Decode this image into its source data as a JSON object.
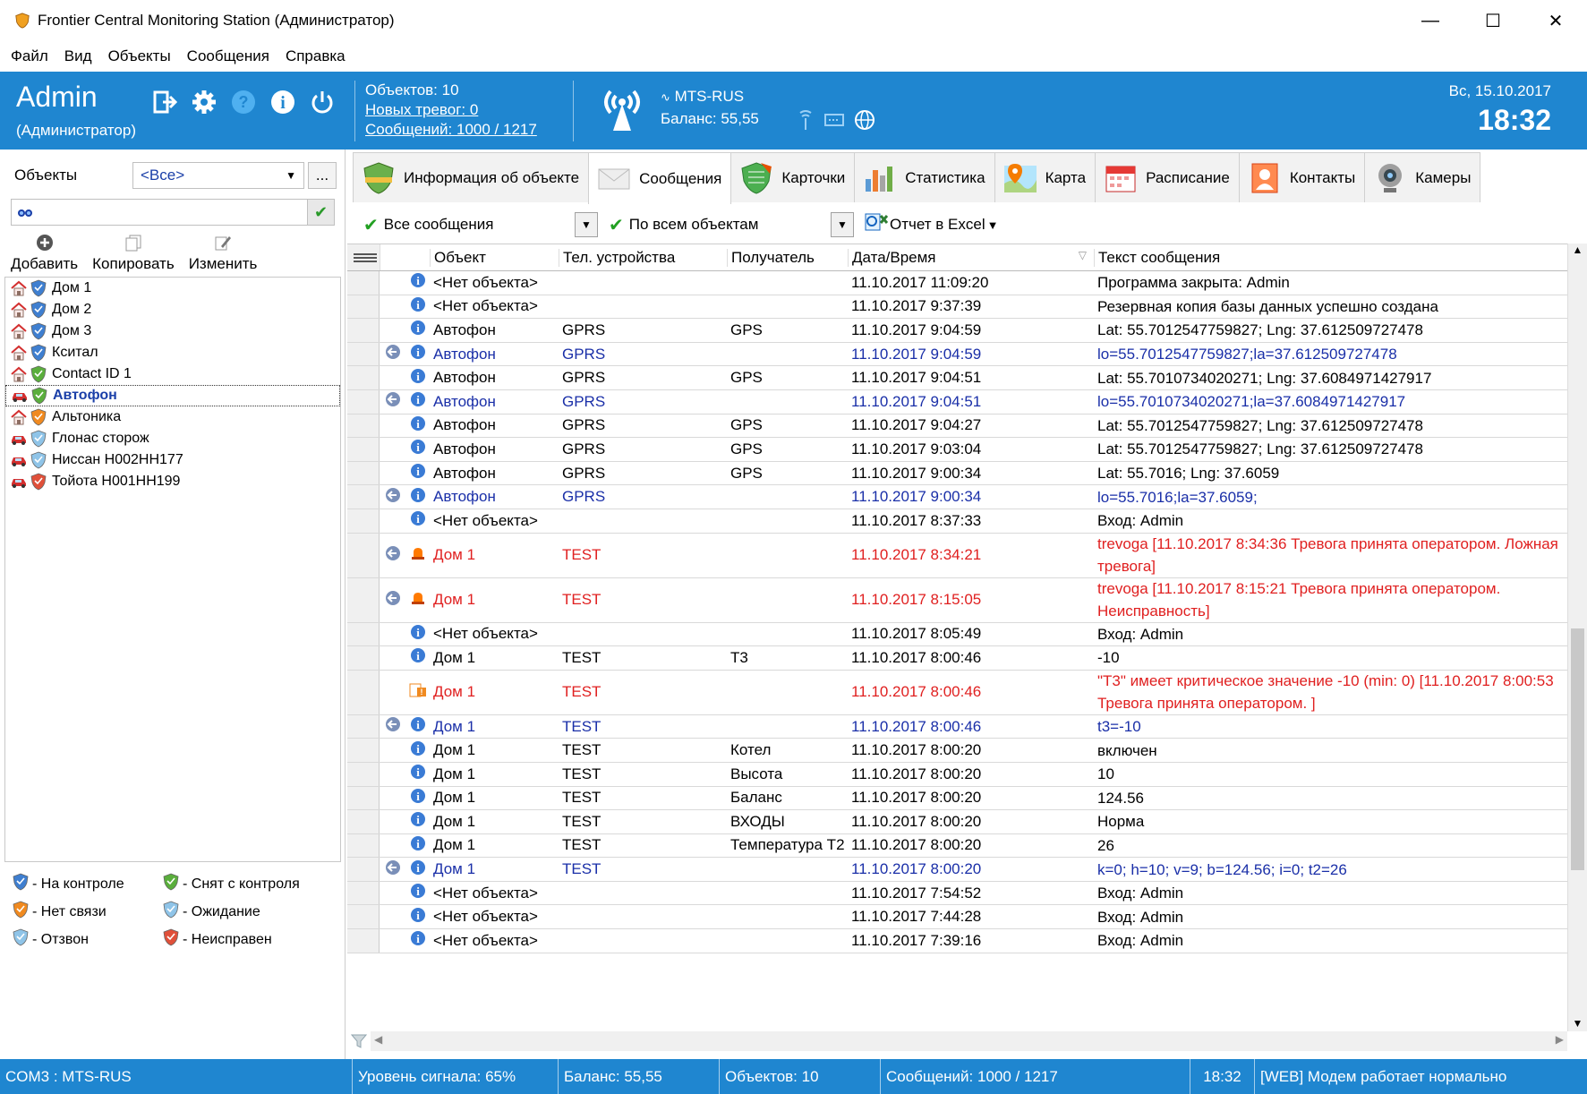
{
  "window": {
    "title": "Frontier Central Monitoring Station (Администратор)"
  },
  "menu": [
    "Файл",
    "Вид",
    "Объекты",
    "Сообщения",
    "Справка"
  ],
  "header": {
    "user": "Admin",
    "role": "(Администратор)",
    "objects": "Объектов:  10",
    "new_alarms": "Новых тревог: 0",
    "messages": "Сообщений:  1000 / 1217",
    "operator": "MTS-RUS",
    "balance": "Баланс:  55,55",
    "date": "Вс, 15.10.2017",
    "time": "18:32"
  },
  "left": {
    "objects_label": "Объекты",
    "filter_value": "<Все>",
    "more_label": "...",
    "search_value": "",
    "actions": {
      "add": "Добавить",
      "copy": "Копировать",
      "edit": "Изменить"
    },
    "tree": [
      {
        "label": "Дом 1",
        "kind": "house",
        "status": "blue"
      },
      {
        "label": "Дом 2",
        "kind": "house",
        "status": "blue"
      },
      {
        "label": "Дом 3",
        "kind": "house",
        "status": "blue"
      },
      {
        "label": "Кситал",
        "kind": "house",
        "status": "blue"
      },
      {
        "label": "Contact ID 1",
        "kind": "house",
        "status": "green"
      },
      {
        "label": "Автофон",
        "kind": "car",
        "status": "green"
      },
      {
        "label": "Альтоника",
        "kind": "house",
        "status": "orange"
      },
      {
        "label": "Глонас сторож",
        "kind": "car",
        "status": "lightblue"
      },
      {
        "label": "Ниссан Н002НН177",
        "kind": "car",
        "status": "lightblue"
      },
      {
        "label": "Тойота Н001НН199",
        "kind": "car",
        "status": "red"
      }
    ],
    "legend": [
      "- На контроле",
      "- Снят с контроля",
      "- Нет связи",
      "- Ожидание",
      "- Отзвон",
      "- Неисправен"
    ]
  },
  "tabs": [
    "Информация об объекте",
    "Сообщения",
    "Карточки",
    "Статистика",
    "Карта",
    "Расписание",
    "Контакты",
    "Камеры"
  ],
  "toolbar": {
    "filter1": "Все сообщения",
    "filter2": "По всем объектам",
    "export": "Отчет в Excel"
  },
  "columns": [
    "Объект",
    "Тел. устройства",
    "Получатель",
    "Дата/Время",
    "Текст сообщения"
  ],
  "rows": [
    {
      "arrow": false,
      "icon": "info",
      "obj": "<Нет объекта>",
      "dev": "",
      "rcpt": "",
      "dt": "11.10.2017 11:09:20",
      "text": "Программа закрыта: Admin",
      "style": ""
    },
    {
      "arrow": false,
      "icon": "info",
      "obj": "<Нет объекта>",
      "dev": "",
      "rcpt": "",
      "dt": "11.10.2017 9:37:39",
      "text": "Резервная копия базы данных успешно создана",
      "style": ""
    },
    {
      "arrow": false,
      "icon": "info",
      "obj": "Автофон",
      "dev": "GPRS",
      "rcpt": "GPS",
      "dt": "11.10.2017 9:04:59",
      "text": "Lat: 55.7012547759827; Lng: 37.612509727478",
      "style": ""
    },
    {
      "arrow": true,
      "icon": "info",
      "obj": "Автофон",
      "dev": "GPRS",
      "rcpt": "",
      "dt": "11.10.2017 9:04:59",
      "text": "lo=55.7012547759827;la=37.612509727478",
      "style": "blue"
    },
    {
      "arrow": false,
      "icon": "info",
      "obj": "Автофон",
      "dev": "GPRS",
      "rcpt": "GPS",
      "dt": "11.10.2017 9:04:51",
      "text": "Lat: 55.7010734020271; Lng: 37.6084971427917",
      "style": ""
    },
    {
      "arrow": true,
      "icon": "info",
      "obj": "Автофон",
      "dev": "GPRS",
      "rcpt": "",
      "dt": "11.10.2017 9:04:51",
      "text": "lo=55.7010734020271;la=37.6084971427917",
      "style": "blue"
    },
    {
      "arrow": false,
      "icon": "info",
      "obj": "Автофон",
      "dev": "GPRS",
      "rcpt": "GPS",
      "dt": "11.10.2017 9:04:27",
      "text": "Lat: 55.7012547759827; Lng: 37.612509727478",
      "style": ""
    },
    {
      "arrow": false,
      "icon": "info",
      "obj": "Автофон",
      "dev": "GPRS",
      "rcpt": "GPS",
      "dt": "11.10.2017 9:03:04",
      "text": "Lat: 55.7012547759827; Lng: 37.612509727478",
      "style": ""
    },
    {
      "arrow": false,
      "icon": "info",
      "obj": "Автофон",
      "dev": "GPRS",
      "rcpt": "GPS",
      "dt": "11.10.2017 9:00:34",
      "text": "Lat: 55.7016; Lng: 37.6059",
      "style": ""
    },
    {
      "arrow": true,
      "icon": "info",
      "obj": "Автофон",
      "dev": "GPRS",
      "rcpt": "",
      "dt": "11.10.2017 9:00:34",
      "text": "lo=55.7016;la=37.6059;",
      "style": "blue"
    },
    {
      "arrow": false,
      "icon": "info",
      "obj": "<Нет объекта>",
      "dev": "",
      "rcpt": "",
      "dt": "11.10.2017 8:37:33",
      "text": "Вход: Admin",
      "style": ""
    },
    {
      "arrow": true,
      "icon": "alarm",
      "obj": "Дом 1",
      "dev": "TEST",
      "rcpt": "",
      "dt": "11.10.2017 8:34:21",
      "text": "trevoga [11.10.2017 8:34:36 Тревога принята оператором. Ложная тревога]",
      "style": "red",
      "tall": true
    },
    {
      "arrow": true,
      "icon": "alarm",
      "obj": "Дом 1",
      "dev": "TEST",
      "rcpt": "",
      "dt": "11.10.2017 8:15:05",
      "text": "trevoga [11.10.2017 8:15:21 Тревога принята оператором. Неисправность]",
      "style": "red",
      "tall": true
    },
    {
      "arrow": false,
      "icon": "info",
      "obj": "<Нет объекта>",
      "dev": "",
      "rcpt": "",
      "dt": "11.10.2017 8:05:49",
      "text": "Вход: Admin",
      "style": ""
    },
    {
      "arrow": false,
      "icon": "info",
      "obj": "Дом 1",
      "dev": "TEST",
      "rcpt": "T3",
      "dt": "11.10.2017 8:00:46",
      "text": "-10",
      "style": ""
    },
    {
      "arrow": false,
      "icon": "warn",
      "obj": "Дом 1",
      "dev": "TEST",
      "rcpt": "",
      "dt": "11.10.2017 8:00:46",
      "text": "\"T3\" имеет критическое значение -10 (min: 0) [11.10.2017 8:00:53 Тревога принята оператором. ]",
      "style": "red",
      "tall": true
    },
    {
      "arrow": true,
      "icon": "info",
      "obj": "Дом 1",
      "dev": "TEST",
      "rcpt": "",
      "dt": "11.10.2017 8:00:46",
      "text": "t3=-10",
      "style": "blue"
    },
    {
      "arrow": false,
      "icon": "info",
      "obj": "Дом 1",
      "dev": "TEST",
      "rcpt": "Котел",
      "dt": "11.10.2017 8:00:20",
      "text": "включен",
      "style": ""
    },
    {
      "arrow": false,
      "icon": "info",
      "obj": "Дом 1",
      "dev": "TEST",
      "rcpt": "Высота",
      "dt": "11.10.2017 8:00:20",
      "text": "10",
      "style": ""
    },
    {
      "arrow": false,
      "icon": "info",
      "obj": "Дом 1",
      "dev": "TEST",
      "rcpt": "Баланс",
      "dt": "11.10.2017 8:00:20",
      "text": "124.56",
      "style": ""
    },
    {
      "arrow": false,
      "icon": "info",
      "obj": "Дом 1",
      "dev": "TEST",
      "rcpt": "ВХОДЫ",
      "dt": "11.10.2017 8:00:20",
      "text": "Норма",
      "style": ""
    },
    {
      "arrow": false,
      "icon": "info",
      "obj": "Дом 1",
      "dev": "TEST",
      "rcpt": "Температура Т2",
      "dt": "11.10.2017 8:00:20",
      "text": "26",
      "style": ""
    },
    {
      "arrow": true,
      "icon": "info",
      "obj": "Дом 1",
      "dev": "TEST",
      "rcpt": "",
      "dt": "11.10.2017 8:00:20",
      "text": "k=0; h=10; v=9; b=124.56; i=0; t2=26",
      "style": "blue"
    },
    {
      "arrow": false,
      "icon": "info",
      "obj": "<Нет объекта>",
      "dev": "",
      "rcpt": "",
      "dt": "11.10.2017 7:54:52",
      "text": "Вход: Admin",
      "style": ""
    },
    {
      "arrow": false,
      "icon": "info",
      "obj": "<Нет объекта>",
      "dev": "",
      "rcpt": "",
      "dt": "11.10.2017 7:44:28",
      "text": "Вход: Admin",
      "style": ""
    },
    {
      "arrow": false,
      "icon": "info",
      "obj": "<Нет объекта>",
      "dev": "",
      "rcpt": "",
      "dt": "11.10.2017 7:39:16",
      "text": "Вход: Admin",
      "style": ""
    }
  ],
  "status": [
    "COM3 :  MTS-RUS",
    "Уровень сигнала:  65%",
    "Баланс:  55,55",
    "Объектов:  10",
    "Сообщений:  1000 / 1217",
    "18:32",
    "[WEB] Модем работает нормально"
  ],
  "colors": {
    "accent": "#1f86d0",
    "blue_text": "#1a2fa8",
    "red_text": "#e02020"
  }
}
